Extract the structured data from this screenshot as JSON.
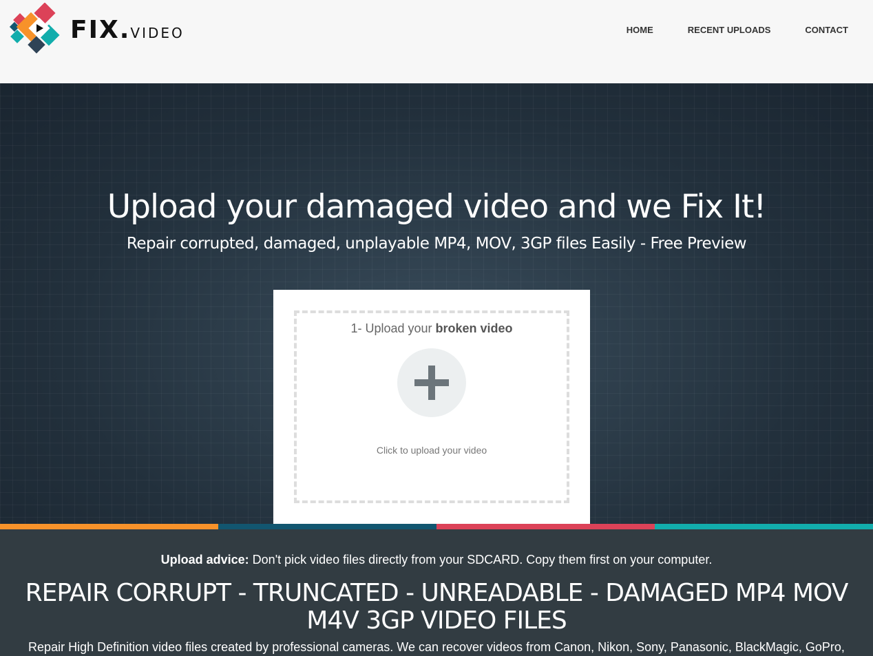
{
  "header": {
    "logo": {
      "main": "FIX.",
      "sub": "VIDEO"
    },
    "nav": [
      "HOME",
      "RECENT UPLOADS",
      "CONTACT"
    ]
  },
  "hero": {
    "title": "Upload your damaged video and we Fix It!",
    "subtitle": "Repair corrupted, damaged, unplayable MP4, MOV, 3GP files Easily - Free Preview",
    "upload": {
      "step": "1- Upload your ",
      "step_bold": "broken video",
      "hint": "Click to upload your video",
      "icon": "plus-icon"
    }
  },
  "colors": {
    "bars": [
      "#f7922a",
      "#125670",
      "#dc4258",
      "#12adac"
    ]
  },
  "footer": {
    "advice_label": "Upload advice:",
    "advice_text": " Don't pick video files directly from your SDCARD. Copy them first on your computer.",
    "headline": "REPAIR CORRUPT - TRUNCATED - UNREADABLE - DAMAGED MP4 MOV M4V 3GP VIDEO FILES",
    "description": "Repair High Definition video files created by professional cameras. We can recover videos from Canon, Nikon, Sony, Panasonic, BlackMagic, GoPro,"
  }
}
